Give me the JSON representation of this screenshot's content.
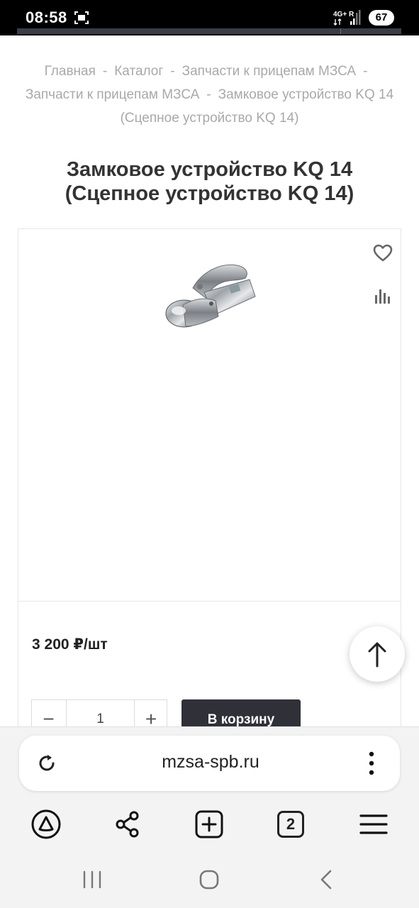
{
  "status_bar": {
    "time": "08:58",
    "network": "4G+",
    "battery": "67"
  },
  "breadcrumb": {
    "items": [
      "Главная",
      "Каталог",
      "Запчасти к прицепам МЗСА",
      "Запчасти к прицепам МЗСА",
      "Замковое устройство KQ 14 (Сцепное устройство KQ 14)"
    ],
    "separator": "-"
  },
  "product": {
    "title": "Замковое устройство KQ 14 (Сцепное устройство KQ 14)",
    "price": "3 200 ₽/шт",
    "quantity": "1",
    "qty_minus": "−",
    "qty_plus": "+",
    "cart_button": "В корзину"
  },
  "browser": {
    "url": "mzsa-spb.ru",
    "tabs_count": "2"
  },
  "icons": {
    "favorite": "heart-icon",
    "compare": "bar-chart-icon",
    "scroll_top": "arrow-up-icon",
    "reload": "reload-icon",
    "menu": "vertical-dots-icon",
    "alice": "alice-assistant-icon",
    "share": "share-icon",
    "new_tab": "plus-square-icon",
    "hamburger": "hamburger-menu-icon",
    "recents": "recent-apps-icon",
    "home": "home-icon",
    "back": "back-icon"
  },
  "colors": {
    "accent_dark": "#2f3038",
    "breadcrumb": "#a9a9a9",
    "title": "#333333"
  }
}
